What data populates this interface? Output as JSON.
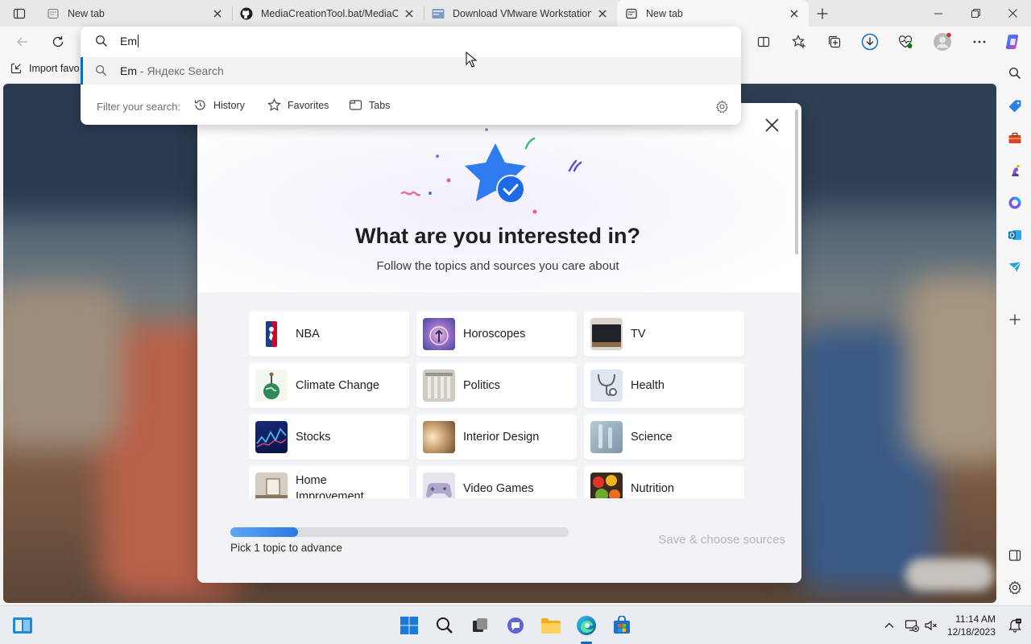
{
  "tabs": [
    {
      "title": "New tab",
      "icon": "newtab-page-icon"
    },
    {
      "title": "MediaCreationTool.bat/MediaCre",
      "icon": "github-icon"
    },
    {
      "title": "Download VMware Workstation",
      "icon": "vmware-page-icon"
    },
    {
      "title": "New tab",
      "icon": "newtab-page-icon",
      "active": true
    }
  ],
  "favorites_bar": {
    "import_label": "Import favo"
  },
  "omnibox": {
    "typed": "Em",
    "suggestion": {
      "query": "Em",
      "engine_suffix": " - Яндекс Search"
    },
    "filter_label": "Filter your search:",
    "filters": [
      "History",
      "Favorites",
      "Tabs"
    ]
  },
  "modal": {
    "title": "What are you interested in?",
    "subtitle": "Follow the topics and sources you care about",
    "topics": [
      "NBA",
      "Horoscopes",
      "TV",
      "Climate Change",
      "Politics",
      "Health",
      "Stocks",
      "Interior Design",
      "Science",
      "Home Improvement",
      "Video Games",
      "Nutrition"
    ],
    "progress_fraction": 0.2,
    "progress_label": "Pick 1 topic to advance",
    "save_label": "Save & choose sources"
  },
  "taskbar": {
    "time": "11:14 AM",
    "date": "12/18/2023"
  },
  "colors": {
    "accent": "#0f6cbd",
    "progress_start": "#5ea6f5",
    "progress_end": "#2f78e6",
    "star_blue": "#2f7bf0"
  }
}
